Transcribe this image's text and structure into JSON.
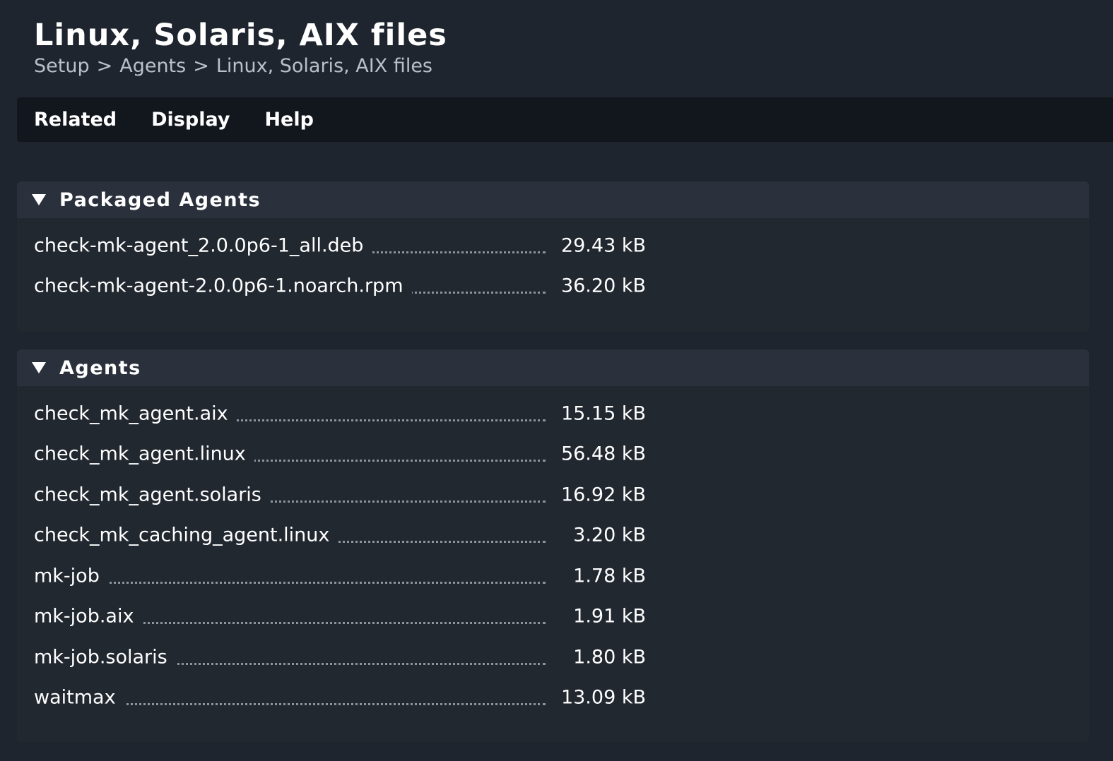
{
  "header": {
    "title": "Linux, Solaris, AIX files",
    "breadcrumb": [
      "Setup",
      "Agents",
      "Linux, Solaris, AIX files"
    ],
    "separator": ">"
  },
  "menu": {
    "items": [
      "Related",
      "Display",
      "Help"
    ]
  },
  "sections": [
    {
      "title": "Packaged Agents",
      "files": [
        {
          "name": "check-mk-agent_2.0.0p6-1_all.deb",
          "size": "29.43 kB"
        },
        {
          "name": "check-mk-agent-2.0.0p6-1.noarch.rpm",
          "size": "36.20 kB"
        }
      ]
    },
    {
      "title": "Agents",
      "files": [
        {
          "name": "check_mk_agent.aix",
          "size": "15.15 kB"
        },
        {
          "name": "check_mk_agent.linux",
          "size": "56.48 kB"
        },
        {
          "name": "check_mk_agent.solaris",
          "size": "16.92 kB"
        },
        {
          "name": "check_mk_caching_agent.linux",
          "size": "3.20 kB"
        },
        {
          "name": "mk-job",
          "size": "1.78 kB"
        },
        {
          "name": "mk-job.aix",
          "size": "1.91 kB"
        },
        {
          "name": "mk-job.solaris",
          "size": "1.80 kB"
        },
        {
          "name": "waitmax",
          "size": "13.09 kB"
        }
      ]
    }
  ],
  "colors": {
    "background": "#1f252e",
    "menubar": "#12171e",
    "section_header": "#2a313c",
    "section_body": "#222830",
    "breadcrumb_text": "#b9c0c9"
  }
}
